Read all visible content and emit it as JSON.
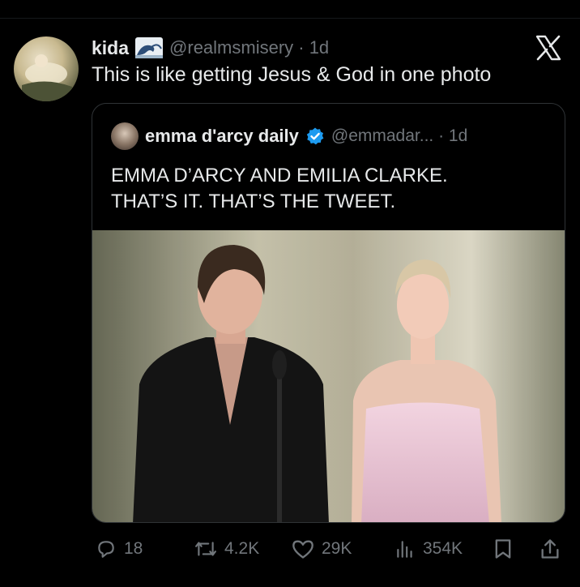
{
  "tweet": {
    "author_name": "kida",
    "badge_icon": "wave-icon",
    "handle_time": "@realmsmisery · 1d",
    "text": "This is like getting Jesus & God in one photo"
  },
  "quoted": {
    "author_name": "emma d'arcy daily",
    "verified_icon": "verified-badge-icon",
    "handle_time": "@emmadar... · 1d",
    "text_lines": [
      "EMMA D’ARCY AND EMILIA CLARKE.",
      "THAT’S IT. THAT’S THE TWEET."
    ]
  },
  "actions": {
    "replies": "18",
    "reposts": "4.2K",
    "likes": "29K",
    "views": "354K"
  },
  "colors": {
    "background": "#000000",
    "text": "#e7e9ea",
    "secondary": "#71767b",
    "verified": "#1d9bf0",
    "border": "#2f3336"
  }
}
